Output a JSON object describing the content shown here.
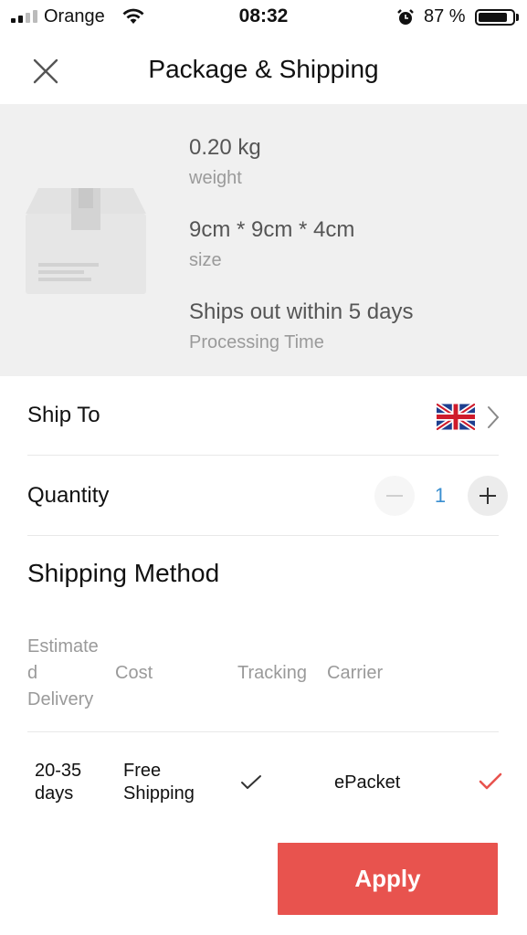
{
  "status_bar": {
    "carrier": "Orange",
    "time": "08:32",
    "battery_percent": "87 %",
    "battery_level": 0.87
  },
  "header": {
    "title": "Package & Shipping",
    "close_icon": "close-icon"
  },
  "package": {
    "weight_value": "0.20 kg",
    "weight_label": "weight",
    "size_value": "9cm * 9cm * 4cm",
    "size_label": "size",
    "processing_value": "Ships out within 5 days",
    "processing_label": "Processing Time"
  },
  "ship_to": {
    "label": "Ship To",
    "flag_icon": "uk-flag-icon"
  },
  "quantity": {
    "label": "Quantity",
    "value": "1"
  },
  "shipping_method": {
    "title": "Shipping Method",
    "columns": {
      "delivery": "Estimate\nd\nDelivery",
      "cost": "Cost",
      "tracking": "Tracking",
      "carrier": "Carrier"
    },
    "rows": [
      {
        "delivery": "20-35\ndays",
        "cost": "Free\nShipping",
        "tracking": true,
        "carrier": "ePacket",
        "selected": true
      }
    ]
  },
  "apply_button": {
    "label": "Apply",
    "color": "#e8534e"
  },
  "colors": {
    "accent": "#e8534e",
    "quantity_text": "#3a8fd0",
    "panel_bg": "#f0f0f0"
  }
}
